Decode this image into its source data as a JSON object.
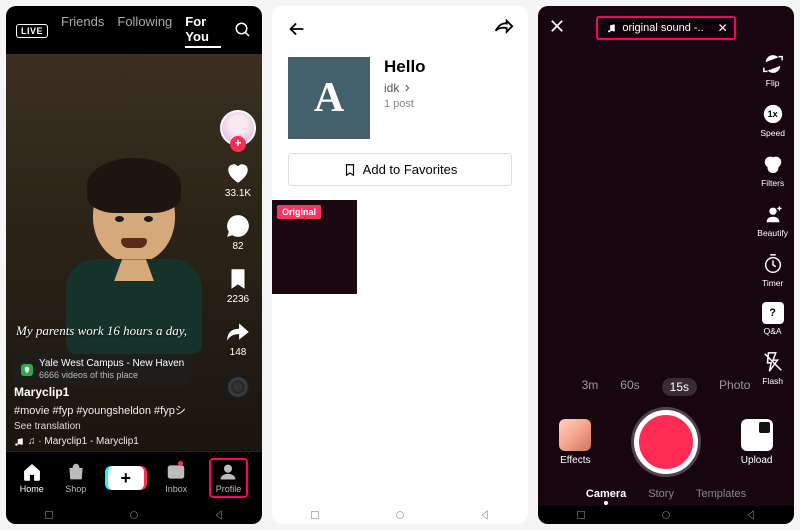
{
  "screen1": {
    "live_label": "LIVE",
    "tabs": {
      "friends": "Friends",
      "following": "Following",
      "foryou": "For You"
    },
    "caption": "My parents work 16 hours a day,",
    "location": {
      "name": "Yale West Campus - New Haven",
      "sub": "6666 videos of this place"
    },
    "meta": {
      "username": "Maryclip1",
      "tags": "#movie #fyp #youngsheldon #fypシ",
      "see_translation": "See translation",
      "music": "♫ · Maryclip1 - Maryclip1"
    },
    "rail": {
      "likes": "33.1K",
      "comments": "82",
      "saves": "2236",
      "shares": "148"
    },
    "nav": {
      "home": "Home",
      "shop": "Shop",
      "inbox": "Inbox",
      "profile": "Profile"
    }
  },
  "screen2": {
    "title": "Hello",
    "author": "idk",
    "post_count": "1 post",
    "add_favorites": "Add to Favorites",
    "cover_letter": "A",
    "tile_badge": "Original"
  },
  "screen3": {
    "sound_label": "original sound -..",
    "rail": {
      "flip": "Flip",
      "speed": "Speed",
      "filters": "Filters",
      "beautify": "Beautify",
      "timer": "Timer",
      "qa": "Q&A",
      "flash": "Flash",
      "speed_value": "1x"
    },
    "durations": {
      "d3m": "3m",
      "d60s": "60s",
      "d15s": "15s",
      "photo": "Photo"
    },
    "sides": {
      "effects": "Effects",
      "upload": "Upload"
    },
    "modes": {
      "camera": "Camera",
      "story": "Story",
      "templates": "Templates"
    }
  }
}
